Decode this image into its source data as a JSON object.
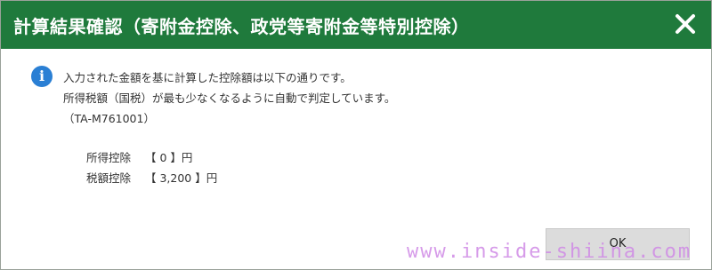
{
  "dialog": {
    "title": "計算結果確認（寄附金控除、政党等寄附金等特別控除）",
    "close_icon": "close-icon",
    "accent_color": "#1f7a3c"
  },
  "message": {
    "icon": "info-icon",
    "line1": "入力された金額を基に計算した控除額は以下の通りです。",
    "line2": "所得税額（国税）が最も少なくなるように自動で判定しています。",
    "line3": "（TA-M761001）"
  },
  "results": [
    {
      "label": "所得控除",
      "value": "【 0 】円"
    },
    {
      "label": "税額控除",
      "value": "【 3,200 】円"
    }
  ],
  "buttons": {
    "ok_label": "OK"
  },
  "watermark": {
    "text": "www.inside-shiina.com"
  }
}
